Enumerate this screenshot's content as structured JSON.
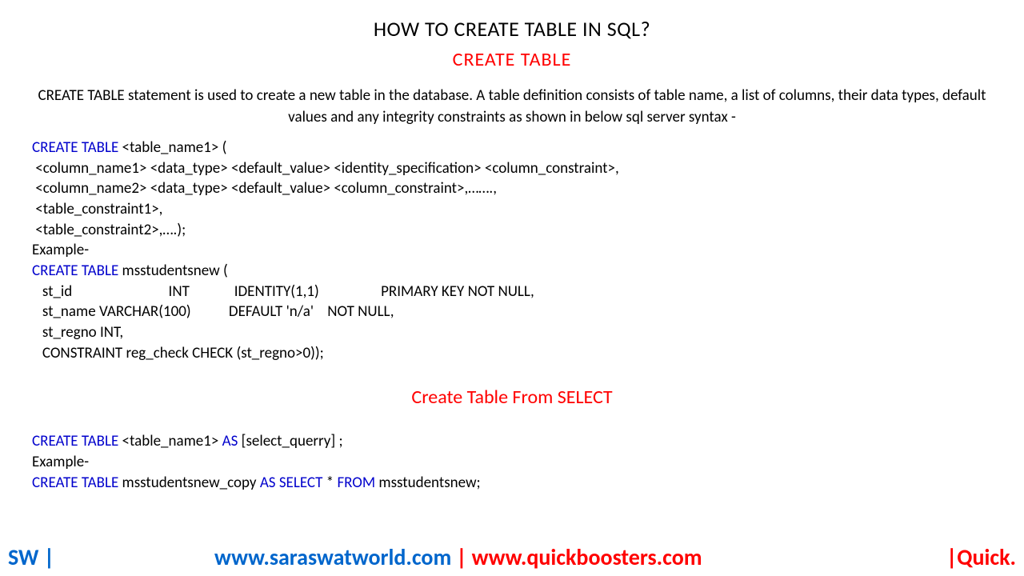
{
  "title": "HOW TO CREATE TABLE IN SQL?",
  "subtitle": "CREATE TABLE",
  "description": "CREATE TABLE statement is used to create a new table in the database. A table definition consists of table name, a list of columns, their data types, default values and any integrity constraints as shown in below sql server syntax -",
  "syntax": {
    "kw1": "CREATE TABLE ",
    "line1_rest": "<table_name1> (",
    "line2": " <column_name1> <data_type> <default_value> <identity_specification> <column_constraint>,",
    "line3": " <column_name2> <data_type> <default_value> <column_constraint>,…….,",
    "line4": " <table_constraint1>,",
    "line5": " <table_constraint2>,….);"
  },
  "example_label": "Example-",
  "example1": {
    "kw": "CREATE TABLE ",
    "rest_open": "msstudentsnew (",
    "row1": "   st_id                            INT             IDENTITY(1,1)                  PRIMARY KEY NOT NULL,",
    "row2": "   st_name VARCHAR(100)           DEFAULT 'n/a'    NOT NULL,",
    "row3": "   st_regno INT,",
    "row4": "   CONSTRAINT reg_check CHECK (st_regno>0));"
  },
  "subtitle2": "Create Table From SELECT",
  "syntax2": {
    "kw1": "CREATE TABLE ",
    "mid1": "<table_name1> ",
    "kw2": "AS ",
    "rest": "[select_querry] ;"
  },
  "example2": {
    "kw1": "CREATE TABLE ",
    "mid1": "msstudentsnew_copy ",
    "kw2": "AS SELECT ",
    "mid2": "* ",
    "kw3": "FROM ",
    "rest": "msstudentsnew;"
  },
  "footer": {
    "sw": "SW |",
    "url1": "www.saraswatworld.com",
    "sep": " | ",
    "url2": "www.quickboosters.com",
    "right": "|Quick."
  }
}
